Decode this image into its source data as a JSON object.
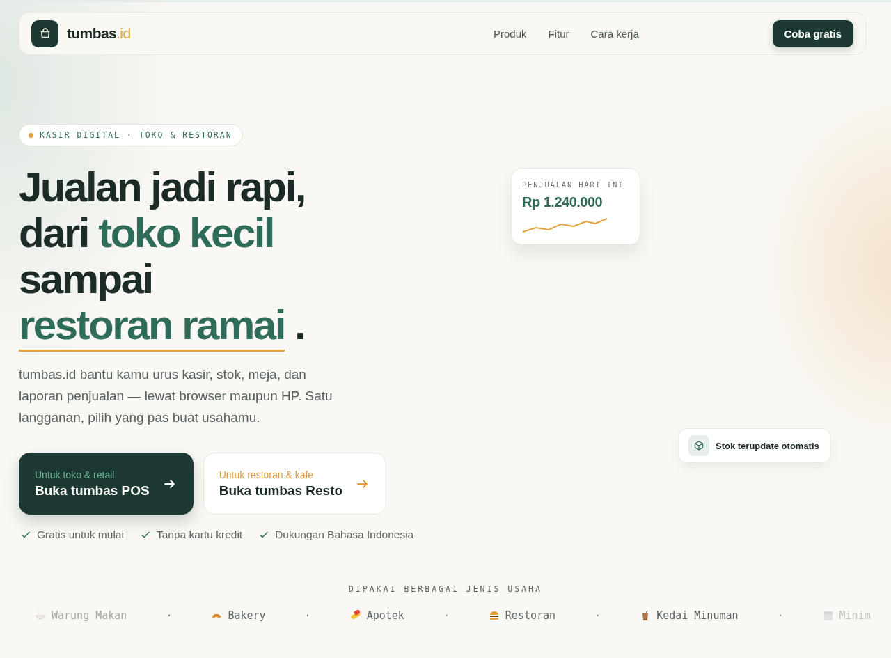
{
  "nav": {
    "brand": "tumbas",
    "brand_suffix": ".id",
    "links": [
      "Produk",
      "Fitur",
      "Cara kerja"
    ],
    "cta": "Coba gratis"
  },
  "hero": {
    "badge": "KASIR DIGITAL · TOKO & RESTORAN",
    "headline": [
      {
        "text": "Jualan jadi rapi,",
        "accent": false,
        "underline": false
      },
      {
        "text": "dari ",
        "accent": false,
        "underline": false
      },
      {
        "text": "toko kecil",
        "accent": true,
        "underline": false
      },
      {
        "text": "sampai",
        "accent": false,
        "underline": false
      },
      {
        "text": "restoran ramai",
        "accent": true,
        "underline": true
      },
      {
        "text": " .",
        "accent": false,
        "underline": false
      }
    ],
    "lead": "tumbas.id bantu kamu urus kasir, stok, meja, dan laporan penjualan — lewat browser maupun HP. Satu langganan, pilih yang pas buat usahamu.",
    "actions": [
      {
        "kind": "primary",
        "eyebrow": "Untuk toko & retail",
        "label": "Buka tumbas POS"
      },
      {
        "kind": "secondary",
        "eyebrow": "Untuk restoran & kafe",
        "label": "Buka tumbas Resto"
      }
    ],
    "perks": [
      "Gratis untuk mulai",
      "Tanpa kartu kredit",
      "Dukungan Bahasa Indonesia"
    ]
  },
  "sales_card": {
    "label": "PENJUALAN HARI INI",
    "amount": "Rp 1.240.000"
  },
  "stock_toast": {
    "text": "Stok terupdate otomatis"
  },
  "usage": {
    "title": "DIPAKAI BERBAGAI JENIS USAHA",
    "items": [
      {
        "kind": "bowl",
        "label": "Warung Makan",
        "separator": "·"
      },
      {
        "kind": "croissant",
        "label": "Bakery",
        "separator": "·"
      },
      {
        "kind": "pill",
        "label": "Apotek",
        "separator": "·"
      },
      {
        "kind": "burger",
        "label": "Restoran",
        "separator": "·"
      },
      {
        "kind": "cup",
        "label": "Kedai Minuman",
        "separator": "·"
      },
      {
        "kind": "store",
        "label": "Minim"
      }
    ]
  }
}
